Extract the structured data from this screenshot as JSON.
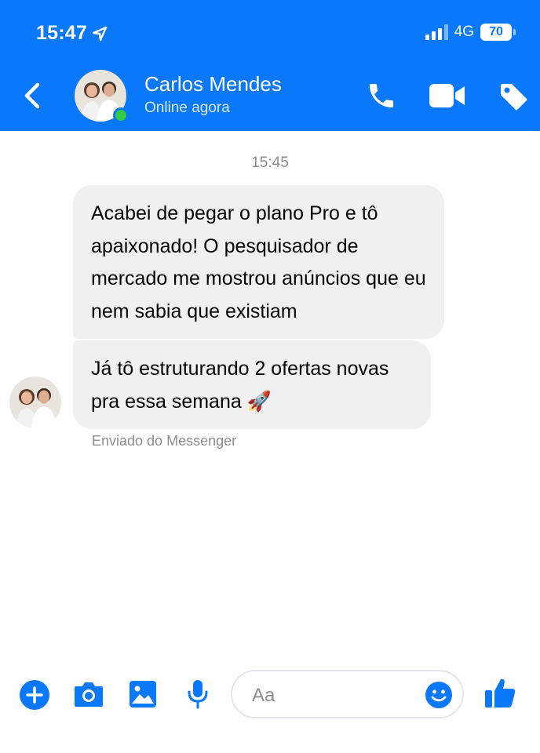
{
  "status_bar": {
    "time": "15:47",
    "network": "4G",
    "battery": "70"
  },
  "header": {
    "contact_name": "Carlos Mendes",
    "contact_status": "Online agora",
    "icons": [
      "back-chevron-icon",
      "phone-icon",
      "video-camera-icon",
      "tag-icon"
    ]
  },
  "conversation": {
    "timestamp": "15:45",
    "messages": [
      {
        "text": "Acabei de pegar o plano Pro e tô apaixonado! O pesquisador de mercado me mostrou anúncios que eu nem sabia que existiam"
      },
      {
        "text": "Já tô estruturando 2 ofertas novas pra essa semana 🚀"
      }
    ],
    "sent_note": "Enviado do Messenger"
  },
  "composer": {
    "placeholder": "Aa",
    "icons": [
      "plus-icon",
      "camera-icon",
      "image-icon",
      "microphone-icon",
      "emoji-icon",
      "thumbs-up-icon"
    ]
  },
  "colors": {
    "brand_blue": "#0a78fa",
    "online_green": "#31cc46",
    "bubble_gray": "#f0f0f0",
    "meta_gray": "#8a8d91"
  }
}
